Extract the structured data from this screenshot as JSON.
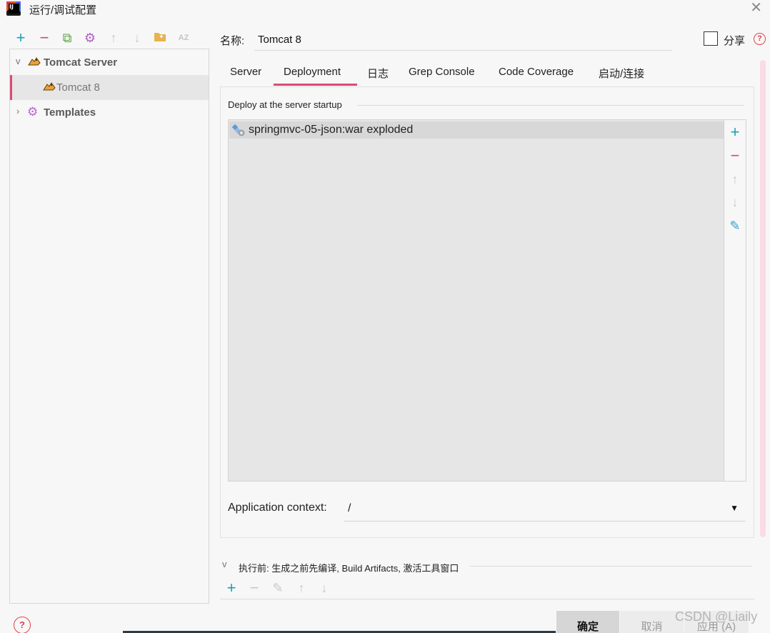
{
  "window": {
    "title": "运行/调试配置"
  },
  "toolbar": {
    "icons": [
      "add-icon",
      "remove-icon",
      "copy-icon",
      "settings-icon",
      "move-up-icon",
      "move-down-icon",
      "folder-icon",
      "sort-icon"
    ],
    "sort_label": "AZ"
  },
  "tree": {
    "items": [
      {
        "label": "Tomcat Server",
        "icon": "tomcat-icon",
        "expanded": true
      },
      {
        "label": "Tomcat 8",
        "icon": "tomcat-icon",
        "selected": true
      },
      {
        "label": "Templates",
        "icon": "gear-icon",
        "expanded": false
      }
    ]
  },
  "form": {
    "name_label": "名称:",
    "name_value": "Tomcat 8",
    "share_label": "分享",
    "share_checked": false
  },
  "tabs": [
    {
      "label": "Server"
    },
    {
      "label": "Deployment",
      "active": true
    },
    {
      "label": "日志"
    },
    {
      "label": "Grep Console"
    },
    {
      "label": "Code Coverage"
    },
    {
      "label": "启动/连接"
    }
  ],
  "deployment": {
    "section_label": "Deploy at the server startup",
    "items": [
      {
        "label": "springmvc-05-json:war exploded",
        "icon": "artifact-icon"
      }
    ],
    "side_tools": [
      "add-icon",
      "remove-icon",
      "move-up-icon",
      "move-down-icon",
      "edit-icon"
    ],
    "context_label": "Application context:",
    "context_value": "/"
  },
  "before_launch": {
    "label": "执行前: 生成之前先编译, Build Artifacts, 激活工具窗口"
  },
  "buttons": {
    "ok": "确定",
    "cancel": "取消",
    "apply": "应用 (A)"
  },
  "watermark": "CSDN @Liaily",
  "colors": {
    "accent": "#d94c74",
    "add": "#1c9fb4",
    "remove": "#d9465b",
    "gear": "#b061c6"
  }
}
